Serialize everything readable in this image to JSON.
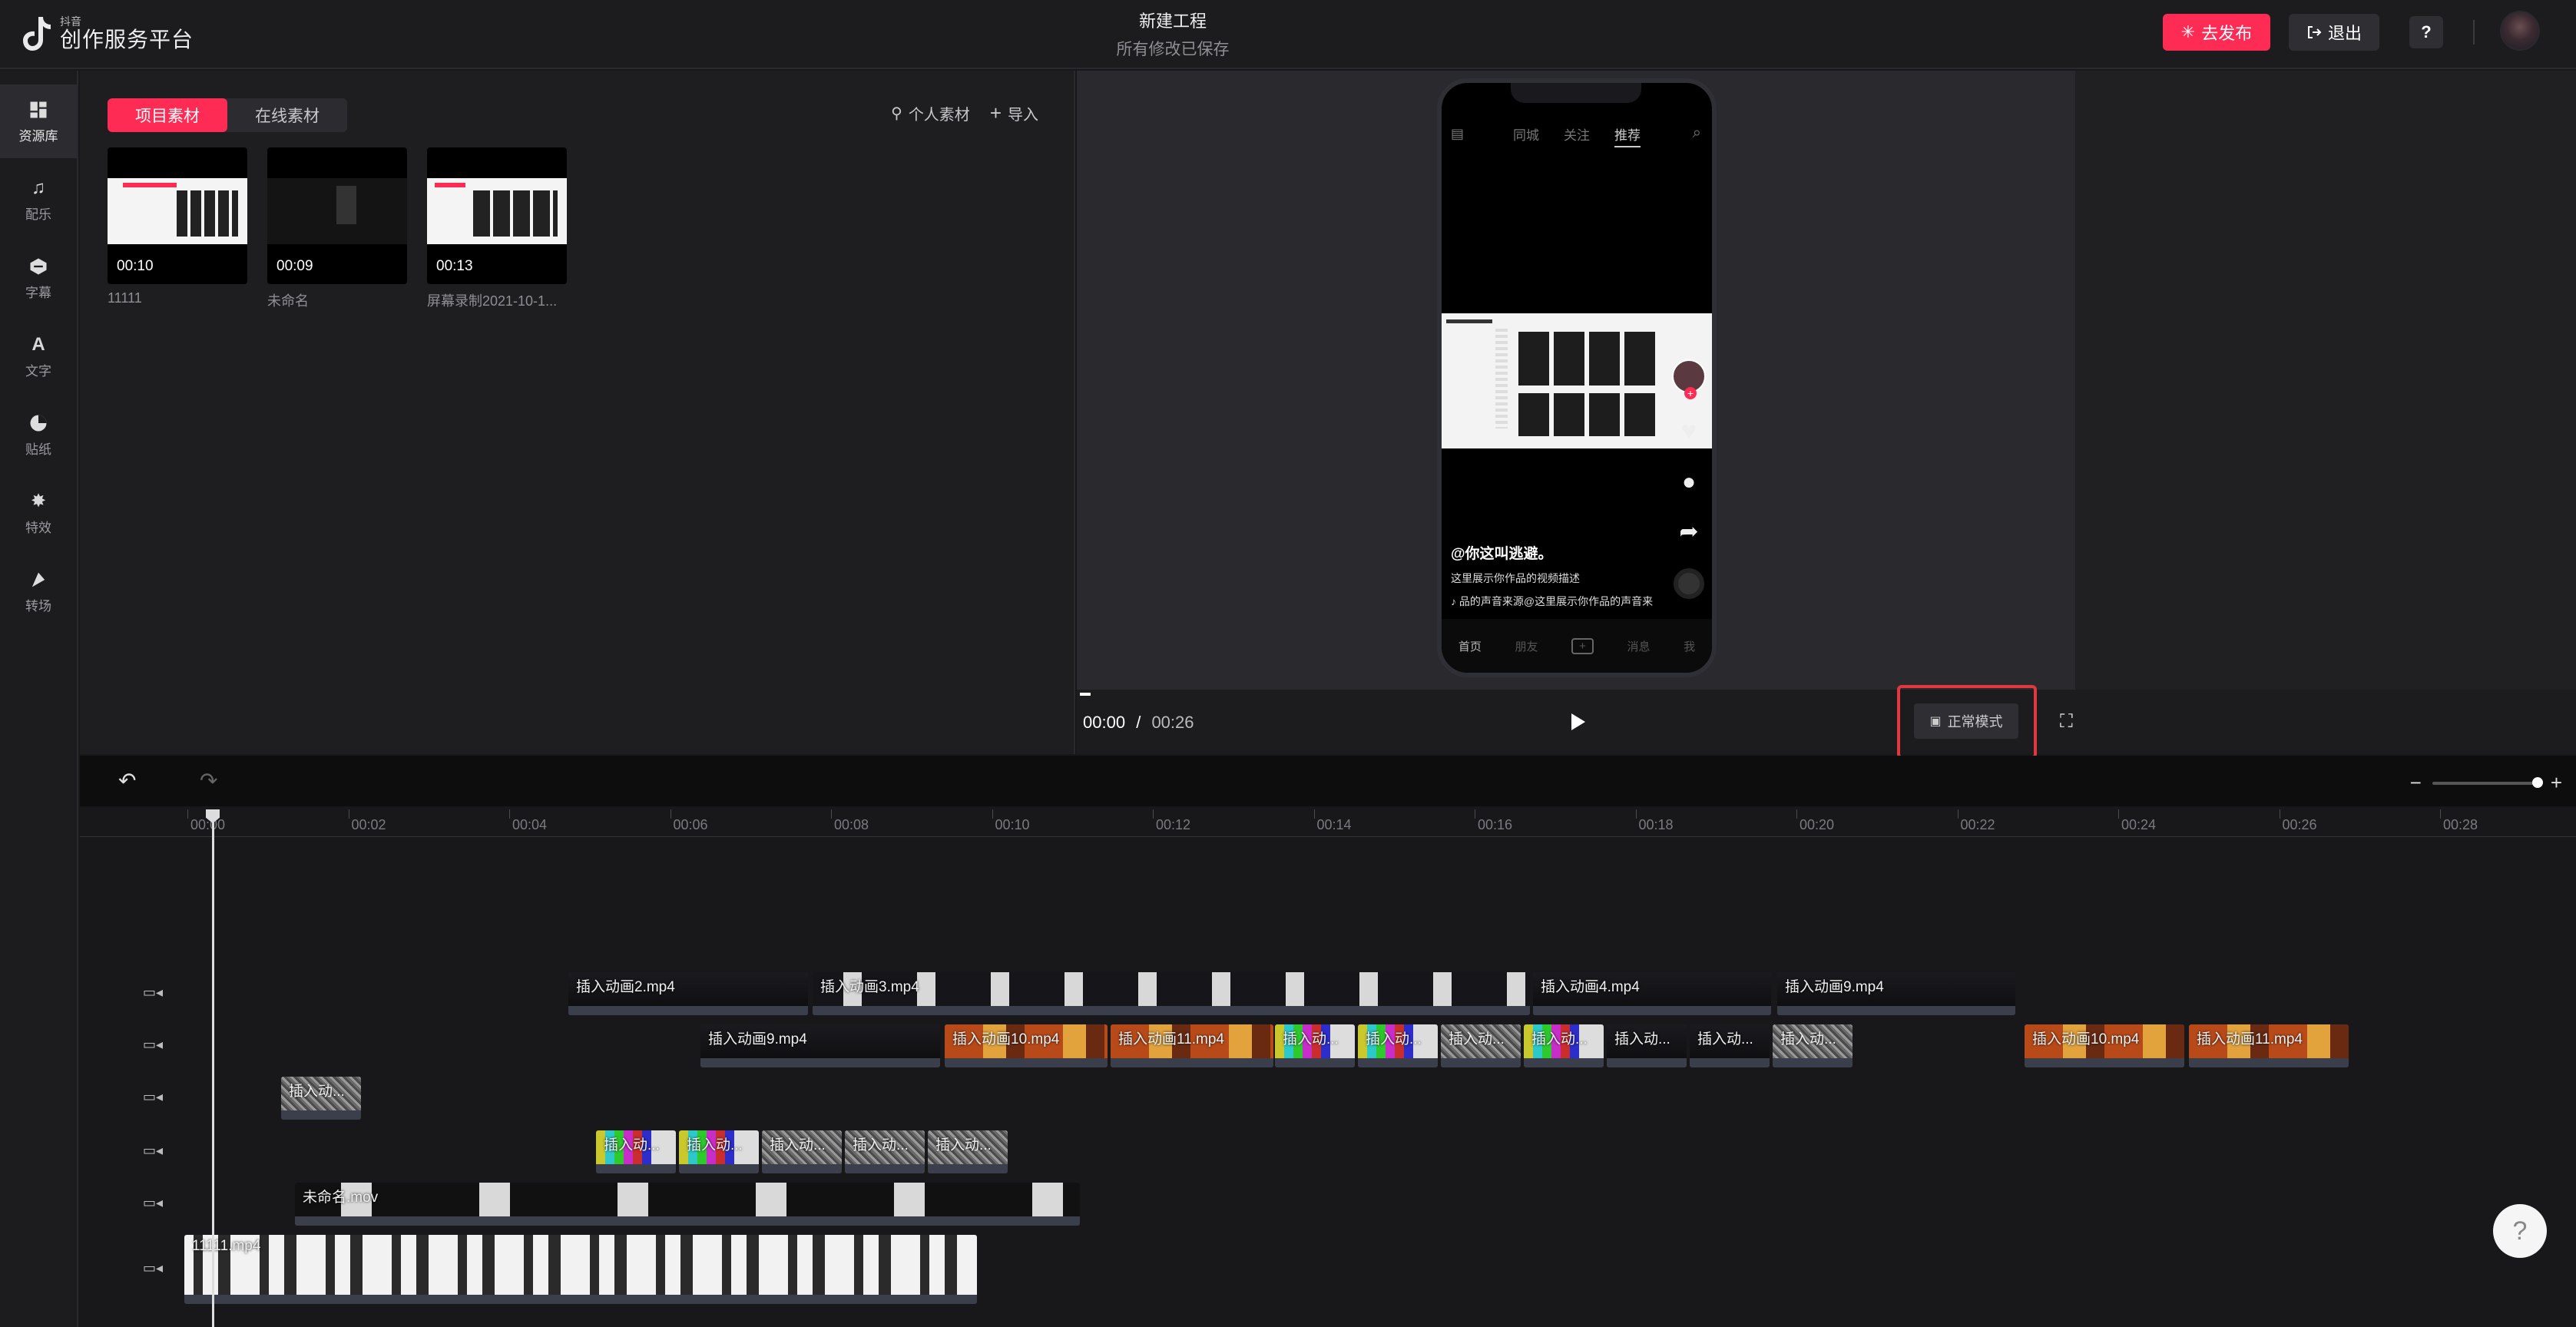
{
  "header": {
    "logo_small": "抖音",
    "logo_main": "创作服务平台",
    "project_title": "新建工程",
    "save_status": "所有修改已保存",
    "publish_label": "去发布",
    "exit_label": "退出",
    "help_label": "?"
  },
  "sidebar": {
    "items": [
      {
        "label": "资源库",
        "icon": "grid-icon"
      },
      {
        "label": "配乐",
        "icon": "music-icon"
      },
      {
        "label": "字幕",
        "icon": "subtitle-icon"
      },
      {
        "label": "文字",
        "icon": "text-icon"
      },
      {
        "label": "贴纸",
        "icon": "sticker-icon"
      },
      {
        "label": "特效",
        "icon": "effects-icon"
      },
      {
        "label": "转场",
        "icon": "transition-icon"
      }
    ]
  },
  "assets": {
    "tabs": [
      "项目素材",
      "在线素材"
    ],
    "personal_label": "个人素材",
    "import_label": "导入",
    "items": [
      {
        "duration": "00:10",
        "name": "11111"
      },
      {
        "duration": "00:09",
        "name": "未命名"
      },
      {
        "duration": "00:13",
        "name": "屏幕录制2021-10-1..."
      }
    ]
  },
  "preview": {
    "phone_tabs": [
      "同城",
      "关注",
      "推荐"
    ],
    "username": "@你这叫逃避。",
    "description": "这里展示你作品的视频描述",
    "music": "品的声音来源@这里展示你作品的声音来",
    "bottom_tabs": [
      "首页",
      "朋友",
      "+",
      "消息",
      "我"
    ],
    "current_time": "00:00",
    "separator": "/",
    "total_time": "00:26",
    "mode_label": "正常模式"
  },
  "timeline": {
    "ruler": [
      "00:00",
      "00:02",
      "00:04",
      "00:06",
      "00:08",
      "00:10",
      "00:12",
      "00:14",
      "00:16",
      "00:18",
      "00:20",
      "00:22",
      "00:24",
      "00:26",
      "00:28"
    ],
    "tracks": [
      {
        "clips": [
          {
            "label": "插入动画2.mp4",
            "style": "dark"
          },
          {
            "label": "插入动画3.mp4",
            "style": "lights"
          },
          {
            "label": "插入动画4.mp4",
            "style": "dark"
          },
          {
            "label": "插入动画9.mp4",
            "style": "dark"
          }
        ]
      },
      {
        "clips": [
          {
            "label": "插入动画9.mp4",
            "style": "dark"
          },
          {
            "label": "插入动画10.mp4",
            "style": "orange"
          },
          {
            "label": "插入动画11.mp4",
            "style": "orange"
          },
          {
            "label": "插入动...",
            "style": "bars"
          },
          {
            "label": "插入动...",
            "style": "bars"
          },
          {
            "label": "插入动...",
            "style": "noise"
          },
          {
            "label": "插入动...",
            "style": "bars"
          },
          {
            "label": "插入动...",
            "style": "dark"
          },
          {
            "label": "插入动...",
            "style": "dark"
          },
          {
            "label": "插入动...",
            "style": "noise"
          },
          {
            "label": "插入动画10.mp4",
            "style": "orange"
          },
          {
            "label": "插入动画11.mp4",
            "style": "orange"
          }
        ]
      },
      {
        "clips": [
          {
            "label": "插入动...",
            "style": "noise"
          }
        ]
      },
      {
        "clips": [
          {
            "label": "插入动...",
            "style": "bars"
          },
          {
            "label": "插入动...",
            "style": "bars"
          },
          {
            "label": "插入动...",
            "style": "noise"
          },
          {
            "label": "插入动...",
            "style": "noise"
          },
          {
            "label": "插入动...",
            "style": "noise"
          }
        ]
      },
      {
        "clips": [
          {
            "label": "未命名.mov",
            "style": "frames"
          }
        ]
      },
      {
        "clips": [
          {
            "label": "11111.mp4",
            "style": "white"
          }
        ]
      }
    ]
  },
  "help_fab": "?"
}
